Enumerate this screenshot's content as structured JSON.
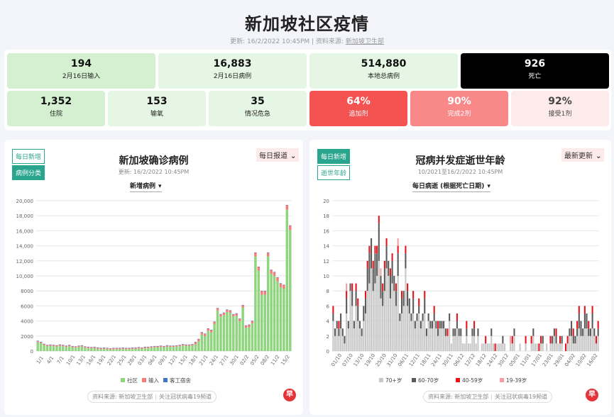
{
  "header": {
    "title": "新加坡社区疫情",
    "updated": "更新: 16/2/2022 10:45PM | 资料来源:",
    "source_link": "新加坡卫生部"
  },
  "stats_row1": [
    {
      "value": "194",
      "label": "2月16日输入"
    },
    {
      "value": "16,883",
      "label": "2月16日病例"
    },
    {
      "value": "514,880",
      "label": "本地总病例"
    },
    {
      "value": "926",
      "label": "死亡"
    }
  ],
  "stats_row2": [
    {
      "value": "1,352",
      "label": "住院"
    },
    {
      "value": "153",
      "label": "输氧"
    },
    {
      "value": "35",
      "label": "情况危急"
    },
    {
      "value": "64%",
      "label": "追加剂"
    },
    {
      "value": "90%",
      "label": "完成2剂"
    },
    {
      "value": "92%",
      "label": "接受1剂"
    }
  ],
  "left_panel": {
    "tabs": [
      "每日新增",
      "病例分类"
    ],
    "title": "新加坡确诊病例",
    "updated": "更新: 16/2/2022 10:45PM",
    "dropdown": "每日报道",
    "metric": "新增病例",
    "source": "资料来源: 新加坡卫生部",
    "follow": "关注冠状病毒19频道",
    "logo": "早"
  },
  "right_panel": {
    "tabs": [
      "每日新增",
      "逝世年龄"
    ],
    "title": "冠病并发症逝世年龄",
    "updated": "10/2021至16/2/2022 10:45PM",
    "dropdown": "最新更新",
    "metric": "每日病逝 (根据死亡日期)",
    "source": "资料来源: 新加坡卫生部",
    "follow": "关注冠状病毒19频道",
    "logo": "早"
  },
  "chart_data": [
    {
      "type": "bar",
      "stacked": true,
      "ylim": [
        0,
        20000
      ],
      "yticks": [
        0,
        2000,
        4000,
        6000,
        8000,
        10000,
        12000,
        14000,
        16000,
        18000,
        20000
      ],
      "ytick_labels": [
        "0",
        "2000",
        "4000",
        "6000",
        "8000",
        "10,000",
        "12,000",
        "14,000",
        "16,000",
        "18,000",
        "20,000"
      ],
      "x_tick_labels": [
        "1/1",
        "4/1",
        "7/1",
        "10/1",
        "13/1",
        "16/1",
        "19/1",
        "22/1",
        "25/1",
        "28/1",
        "03/1",
        "06/1",
        "09/1",
        "12/1",
        "15/1",
        "18/1",
        "21/1",
        "24/1",
        "27/1",
        "30/1",
        "02/2",
        "05/2",
        "08/2",
        "11/2",
        "15/2"
      ],
      "legend": [
        {
          "name": "社区",
          "color": "#8fd47e"
        },
        {
          "name": "输入",
          "color": "#f47c7c"
        },
        {
          "name": "客工宿舍",
          "color": "#3b78c4"
        }
      ],
      "series": [
        {
          "name": "社区",
          "color": "#8fd47e",
          "values": [
            1200,
            1050,
            800,
            650,
            700,
            650,
            600,
            700,
            650,
            550,
            650,
            500,
            450,
            550,
            600,
            450,
            400,
            350,
            400,
            300,
            250,
            300,
            250,
            200,
            250,
            250,
            250,
            300,
            250,
            250,
            300,
            300,
            350,
            300,
            400,
            400,
            450,
            500,
            500,
            550,
            500,
            600,
            550,
            550,
            600,
            650,
            750,
            700,
            700,
            750,
            900,
            1300,
            2200,
            2000,
            2700,
            2500,
            3600,
            5400,
            4600,
            4800,
            5200,
            5100,
            4600,
            4700,
            4000,
            5800,
            3100,
            3200,
            3700,
            12600,
            10700,
            7500,
            7500,
            12600,
            10300,
            10000,
            9300,
            8500,
            8300,
            18800,
            16100
          ]
        },
        {
          "name": "输入",
          "color": "#f47c7c",
          "values": [
            150,
            150,
            150,
            150,
            150,
            150,
            150,
            150,
            150,
            150,
            150,
            150,
            150,
            150,
            150,
            150,
            150,
            150,
            150,
            150,
            150,
            150,
            150,
            150,
            150,
            150,
            150,
            150,
            150,
            150,
            150,
            150,
            150,
            150,
            150,
            150,
            150,
            150,
            150,
            150,
            150,
            150,
            150,
            150,
            150,
            150,
            150,
            150,
            150,
            150,
            300,
            300,
            300,
            300,
            300,
            300,
            300,
            300,
            300,
            300,
            300,
            300,
            300,
            300,
            300,
            300,
            300,
            300,
            300,
            500,
            500,
            500,
            500,
            500,
            500,
            500,
            500,
            500,
            500,
            600,
            600
          ]
        },
        {
          "name": "客工宿舍",
          "color": "#3b78c4",
          "values": [
            20,
            20,
            20,
            20,
            20,
            20,
            20,
            20,
            20,
            20,
            20,
            20,
            20,
            20,
            20,
            20,
            20,
            20,
            20,
            20,
            20,
            20,
            20,
            20,
            20,
            20,
            20,
            20,
            20,
            20,
            20,
            20,
            20,
            20,
            20,
            20,
            20,
            20,
            20,
            20,
            20,
            20,
            20,
            20,
            20,
            20,
            20,
            20,
            20,
            20,
            20,
            20,
            20,
            20,
            20,
            20,
            20,
            20,
            20,
            20,
            20,
            20,
            20,
            20,
            20,
            20,
            20,
            20,
            20,
            20,
            20,
            20,
            20,
            20,
            20,
            20,
            20,
            20,
            20,
            20,
            20
          ]
        }
      ]
    },
    {
      "type": "bar",
      "stacked": true,
      "ylim": [
        0,
        20
      ],
      "yticks": [
        0,
        2,
        4,
        6,
        8,
        10,
        12,
        14,
        16,
        18,
        20
      ],
      "x_tick_labels": [
        "01/10",
        "07/10",
        "13/10",
        "19/10",
        "25/10",
        "31/10",
        "06/11",
        "12/11",
        "18/11",
        "24/11",
        "30/11",
        "06/12",
        "12/12",
        "18/12",
        "24/12",
        "30/12",
        "05/01",
        "11/01",
        "17/01",
        "23/01",
        "29/01",
        "04/02",
        "10/02",
        "16/02"
      ],
      "legend": [
        {
          "name": "70+岁",
          "color": "#c8c8c8"
        },
        {
          "name": "60-70岁",
          "color": "#5a5a5a"
        },
        {
          "name": "40-59岁",
          "color": "#e8141c"
        },
        {
          "name": "19-39岁",
          "color": "#f4a0a0"
        }
      ],
      "series": [
        {
          "name": "70+岁",
          "color": "#c8c8c8",
          "values": [
            4,
            2,
            3,
            2,
            3,
            2,
            1,
            5,
            3,
            8,
            6,
            3,
            6,
            4,
            3,
            2,
            4,
            5,
            8,
            9,
            11,
            8,
            9,
            10,
            12,
            7,
            6,
            8,
            11,
            10,
            7,
            9,
            8,
            6,
            10,
            4,
            5,
            6,
            11,
            6,
            5,
            4,
            5,
            3,
            4,
            5,
            3,
            4,
            5,
            2,
            4,
            3,
            3,
            4,
            3,
            2,
            3,
            3,
            3,
            2,
            2,
            4,
            1,
            2,
            2,
            3,
            2,
            2,
            1,
            1,
            2,
            1,
            1,
            2,
            2,
            1,
            2,
            0,
            1,
            1,
            1,
            1,
            1,
            2,
            1,
            0,
            1,
            1,
            1,
            1,
            1,
            0,
            0,
            1,
            1,
            2,
            0,
            0,
            1,
            0,
            0,
            1,
            0,
            0,
            1,
            2,
            1,
            1,
            0,
            1,
            1,
            0,
            1,
            0,
            1,
            1,
            2,
            1,
            1,
            1,
            1,
            0,
            0,
            1,
            2,
            2,
            1,
            1,
            2,
            3,
            2,
            2,
            3,
            3,
            2,
            2,
            3,
            2,
            1,
            2
          ]
        },
        {
          "name": "60-70岁",
          "color": "#5a5a5a",
          "values": [
            1,
            1,
            1,
            1,
            2,
            1,
            1,
            2,
            1,
            1,
            2,
            1,
            2,
            2,
            1,
            1,
            2,
            2,
            3,
            4,
            4,
            3,
            4,
            3,
            5,
            3,
            2,
            3,
            3,
            2,
            3,
            3,
            2,
            2,
            3,
            1,
            2,
            2,
            2,
            2,
            2,
            1,
            2,
            1,
            1,
            1,
            1,
            1,
            2,
            1,
            1,
            1,
            1,
            1,
            1,
            1,
            1,
            1,
            1,
            1,
            0,
            1,
            0,
            1,
            1,
            1,
            1,
            1,
            0,
            0,
            1,
            0,
            0,
            1,
            1,
            0,
            1,
            0,
            0,
            0,
            0,
            0,
            0,
            1,
            0,
            0,
            0,
            0,
            0,
            1,
            0,
            0,
            0,
            0,
            0,
            1,
            0,
            0,
            0,
            0,
            0,
            0,
            0,
            0,
            0,
            1,
            0,
            0,
            0,
            0,
            1,
            0,
            0,
            0,
            0,
            1,
            1,
            1,
            0,
            0,
            1,
            0,
            0,
            0,
            1,
            2,
            1,
            1,
            1,
            2,
            2,
            1,
            2,
            2,
            1,
            1,
            2,
            1,
            0,
            1
          ]
        },
        {
          "name": "40-59岁",
          "color": "#e8141c",
          "values": [
            1,
            0,
            0,
            1,
            0,
            0,
            0,
            1,
            0,
            0,
            1,
            0,
            1,
            1,
            0,
            0,
            0,
            1,
            1,
            1,
            0,
            1,
            1,
            1,
            1,
            0,
            1,
            1,
            1,
            0,
            1,
            1,
            0,
            1,
            1,
            0,
            1,
            0,
            1,
            1,
            0,
            0,
            1,
            0,
            0,
            1,
            0,
            0,
            1,
            0,
            0,
            0,
            0,
            1,
            0,
            1,
            0,
            0,
            0,
            0,
            1,
            0,
            0,
            0,
            0,
            1,
            0,
            0,
            0,
            0,
            1,
            0,
            0,
            0,
            1,
            0,
            0,
            0,
            0,
            0,
            1,
            0,
            0,
            0,
            0,
            1,
            0,
            0,
            0,
            0,
            0,
            0,
            0,
            0,
            1,
            0,
            0,
            0,
            0,
            0,
            0,
            1,
            0,
            0,
            1,
            0,
            0,
            0,
            1,
            1,
            0,
            0,
            0,
            0,
            1,
            0,
            0,
            1,
            0,
            1,
            0,
            0,
            1,
            1,
            0,
            0,
            1,
            0,
            1,
            1,
            0,
            0,
            1,
            0,
            1,
            0,
            1,
            0,
            1,
            1
          ]
        },
        {
          "name": "19-39岁",
          "color": "#f4a0a0",
          "values": [
            0,
            0,
            0,
            0,
            0,
            0,
            0,
            1,
            0,
            0,
            0,
            0,
            0,
            0,
            0,
            0,
            0,
            0,
            0,
            0,
            0,
            0,
            0,
            0,
            0,
            1,
            0,
            0,
            0,
            0,
            0,
            0,
            0,
            0,
            1,
            0,
            0,
            0,
            0,
            0,
            0,
            0,
            0,
            0,
            0,
            0,
            0,
            0,
            0,
            0,
            0,
            0,
            0,
            0,
            0,
            0,
            0,
            0,
            0,
            0,
            0,
            0,
            0,
            0,
            0,
            0,
            0,
            0,
            0,
            0,
            0,
            0,
            0,
            0,
            0,
            0,
            0,
            0,
            0,
            0,
            0,
            0,
            0,
            0,
            0,
            0,
            0,
            0,
            0,
            0,
            0,
            0,
            0,
            1,
            0,
            0,
            0,
            0,
            0,
            0,
            0,
            0,
            0,
            0,
            0,
            0,
            0,
            0,
            0,
            0,
            0,
            0,
            0,
            0,
            0,
            0,
            0,
            0,
            0,
            0,
            0,
            0,
            0,
            0,
            0,
            0,
            0,
            0,
            0,
            0,
            0,
            0,
            0,
            0,
            0,
            0,
            0,
            0,
            0,
            0
          ]
        }
      ]
    }
  ]
}
